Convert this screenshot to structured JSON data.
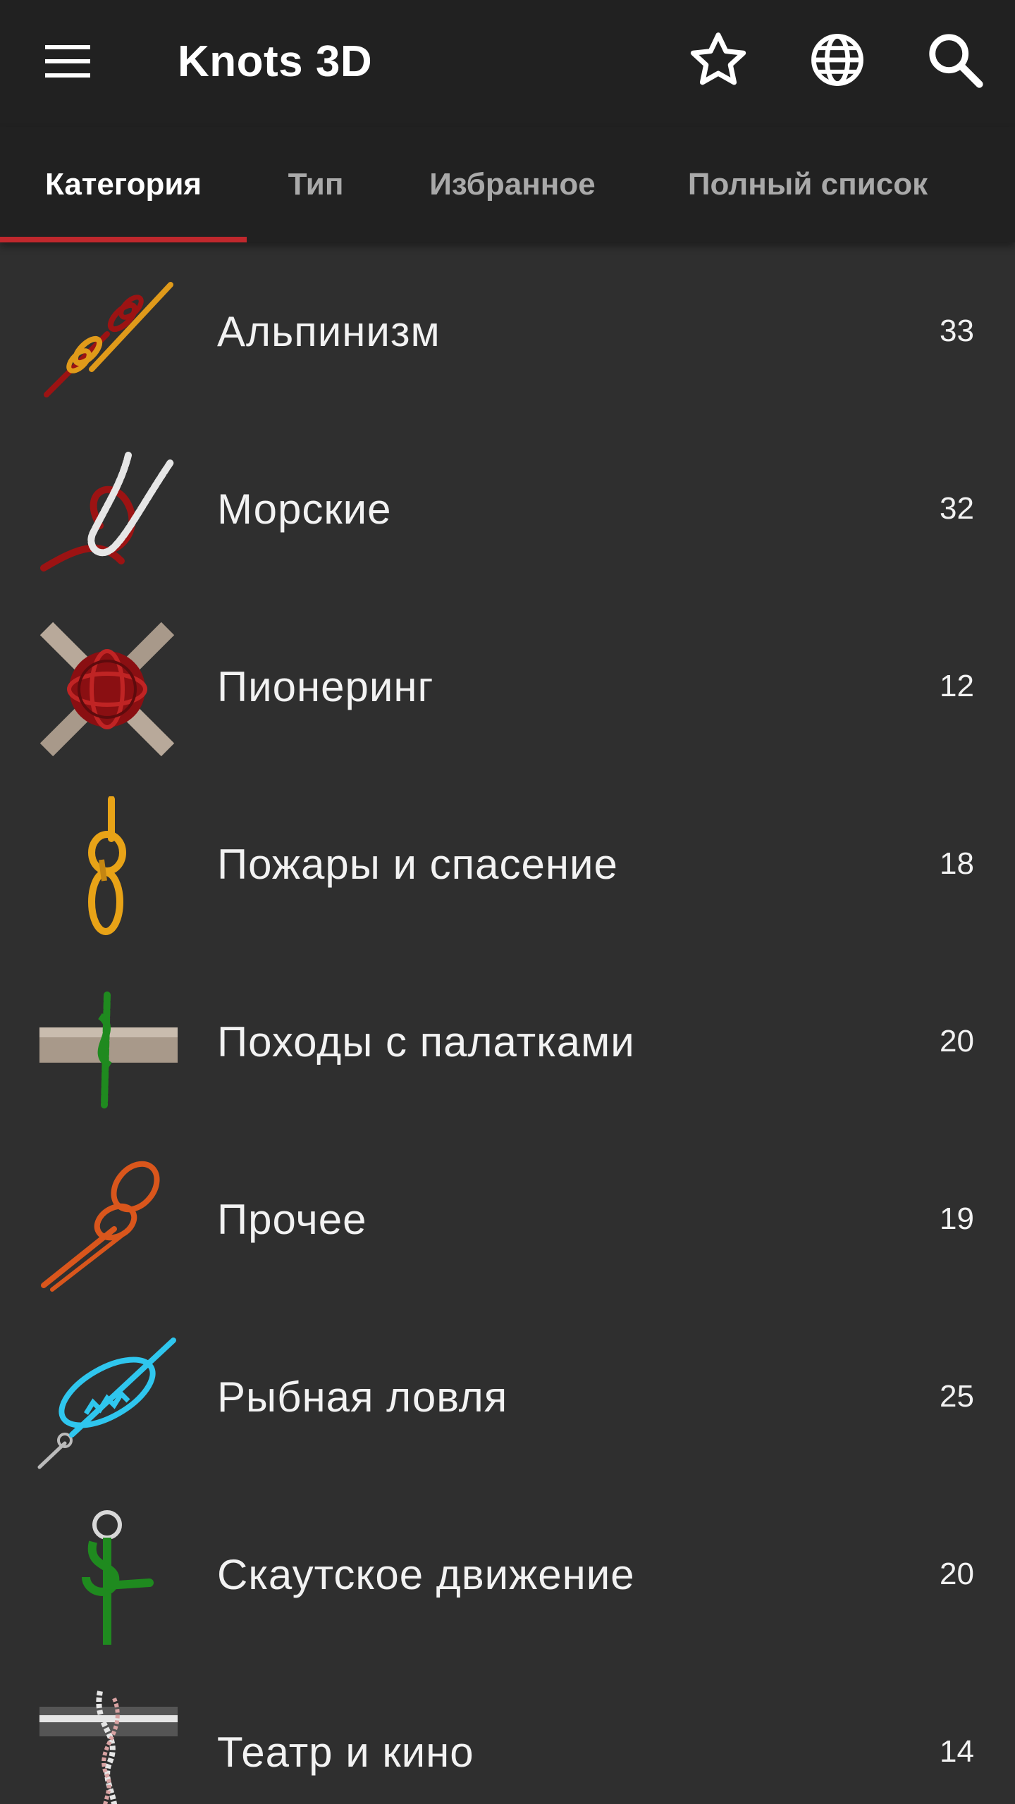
{
  "app": {
    "title": "Knots 3D"
  },
  "toolbar": {
    "menu_icon": "hamburger-menu-icon",
    "favorite_icon": "star-outline-icon",
    "language_icon": "globe-icon",
    "search_icon": "search-icon"
  },
  "tabs": [
    {
      "label": "Категория",
      "active": true
    },
    {
      "label": "Тип",
      "active": false
    },
    {
      "label": "Избранное",
      "active": false
    },
    {
      "label": "Полный список",
      "active": false
    }
  ],
  "colors": {
    "appbar_bg": "#212121",
    "list_bg": "#2f2f2f",
    "tab_indicator": "#c0282d"
  },
  "categories": [
    {
      "label": "Альпинизм",
      "count": "33",
      "icon": "climbing-knot-icon"
    },
    {
      "label": "Морские",
      "count": "32",
      "icon": "boating-knot-icon"
    },
    {
      "label": "Пионеринг",
      "count": "12",
      "icon": "lashing-knot-icon"
    },
    {
      "label": "Пожары и спасение",
      "count": "18",
      "icon": "rescue-knot-icon"
    },
    {
      "label": "Походы с палатками",
      "count": "20",
      "icon": "camping-knot-icon"
    },
    {
      "label": "Прочее",
      "count": "19",
      "icon": "misc-knot-icon"
    },
    {
      "label": "Рыбная ловля",
      "count": "25",
      "icon": "fishing-knot-icon"
    },
    {
      "label": "Скаутское движение",
      "count": "20",
      "icon": "scouting-knot-icon"
    },
    {
      "label": "Театр и кино",
      "count": "14",
      "icon": "theater-knot-icon"
    }
  ]
}
